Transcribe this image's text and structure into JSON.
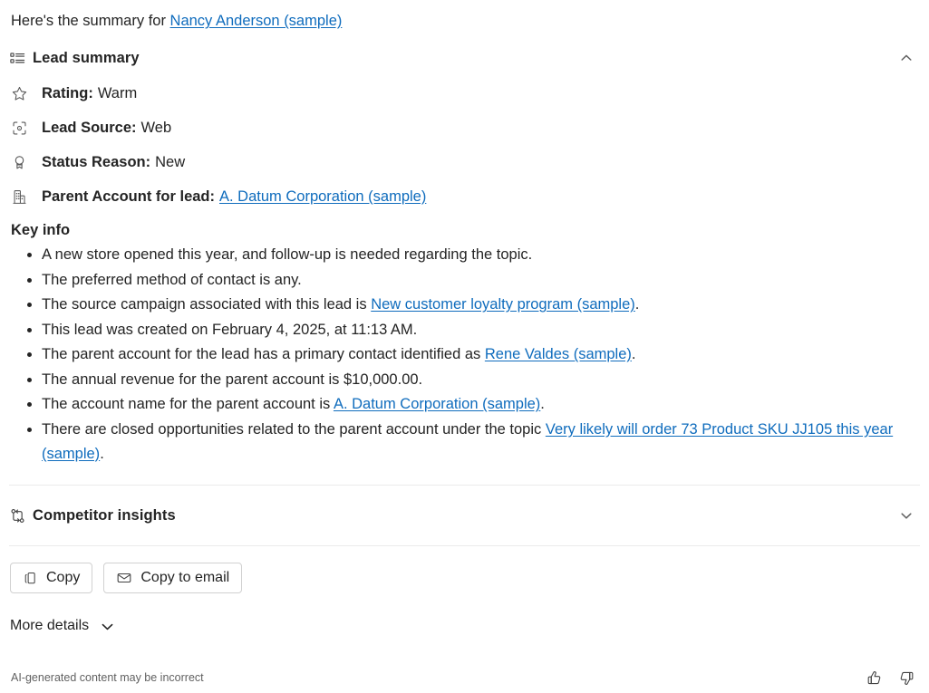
{
  "intro": {
    "prefix": "Here's the summary for ",
    "link": "Nancy Anderson (sample)"
  },
  "lead_summary": {
    "title": "Lead summary",
    "icon": "bulleted-list-icon",
    "expanded": true,
    "chevron": "chevron-up-icon",
    "fields": [
      {
        "icon": "star-icon",
        "label": "Rating:",
        "value": "Warm"
      },
      {
        "icon": "lead-source-icon",
        "label": "Lead Source:",
        "value": "Web"
      },
      {
        "icon": "ribbon-icon",
        "label": "Status Reason:",
        "value": "New"
      },
      {
        "icon": "building-icon",
        "label": "Parent Account for lead:",
        "value": "A. Datum Corporation (sample)",
        "value_is_link": true
      }
    ]
  },
  "key_info": {
    "title": "Key info",
    "bullets": [
      {
        "segments": [
          {
            "t": "A new store opened this year, and follow-up is needed regarding the topic."
          }
        ]
      },
      {
        "segments": [
          {
            "t": "The preferred method of contact is any."
          }
        ]
      },
      {
        "segments": [
          {
            "t": "The source campaign associated with this lead is "
          },
          {
            "t": "New customer loyalty program (sample)",
            "link": true
          },
          {
            "t": "."
          }
        ]
      },
      {
        "segments": [
          {
            "t": "This lead was created on February 4, 2025, at 11:13 AM."
          }
        ]
      },
      {
        "segments": [
          {
            "t": "The parent account for the lead has a primary contact identified as "
          },
          {
            "t": "Rene Valdes (sample)",
            "link": true
          },
          {
            "t": "."
          }
        ]
      },
      {
        "segments": [
          {
            "t": "The annual revenue for the parent account is $10,000.00."
          }
        ]
      },
      {
        "segments": [
          {
            "t": "The account name for the parent account is "
          },
          {
            "t": "A. Datum Corporation (sample)",
            "link": true
          },
          {
            "t": "."
          }
        ]
      },
      {
        "segments": [
          {
            "t": "There are closed opportunities related to the parent account under the topic "
          },
          {
            "t": "Very likely will order 73 Product SKU JJ105 this year (sample)",
            "link": true
          },
          {
            "t": "."
          }
        ]
      }
    ]
  },
  "competitor_insights": {
    "title": "Competitor insights",
    "icon": "branch-flow-icon",
    "expanded": false,
    "chevron": "chevron-down-icon"
  },
  "actions": {
    "copy": {
      "label": "Copy",
      "icon": "copy-icon"
    },
    "copy_to_email": {
      "label": "Copy to email",
      "icon": "mail-icon"
    }
  },
  "more_details": {
    "label": "More details",
    "chevron": "chevron-down-icon"
  },
  "footer": {
    "disclaimer": "AI-generated content may be incorrect",
    "thumbs_up": "thumbs-up-icon",
    "thumbs_down": "thumbs-down-icon"
  },
  "colors": {
    "link": "#0f6cbd",
    "text": "#242424",
    "muted": "#616161",
    "divider": "#ebebeb",
    "button_border": "#d1d1d1"
  }
}
